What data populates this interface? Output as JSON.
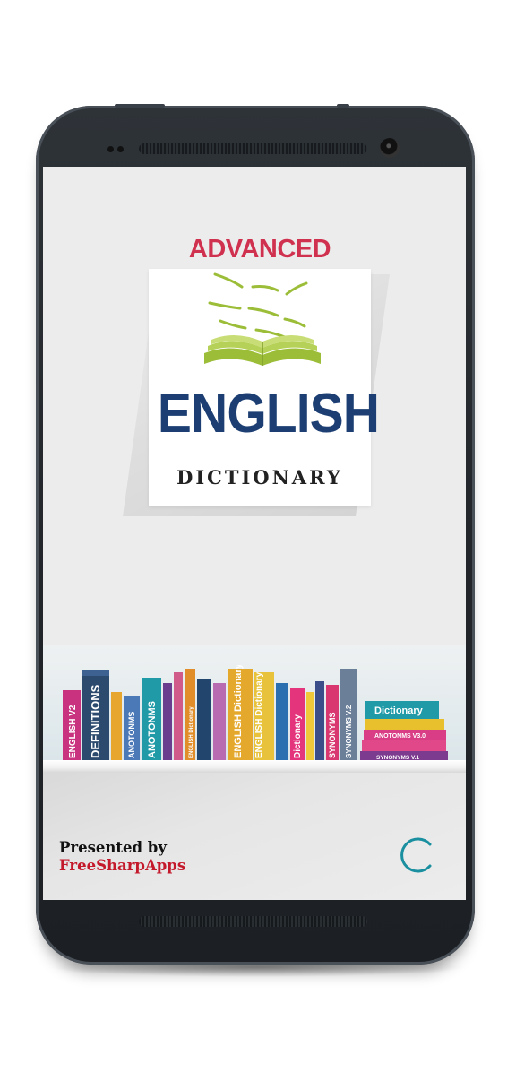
{
  "splash": {
    "logo_top": "ADVANCED",
    "logo_main": "ENGLISH",
    "logo_sub": "DICTIONARY"
  },
  "books": [
    "ENGLISH V2",
    "DEFINITIONS",
    "ANOTONMS",
    "ANOTONMS",
    "ENGLISH Dictionary",
    "ENGLISH Dictionary",
    "ENGLISH Dictionary",
    "Dictionary",
    "SYNONYMS",
    "SYNONYMS V.2"
  ],
  "stack_books": [
    "Dictionary",
    "ANOTONMS V3.0",
    "SYNONYMS V.1"
  ],
  "footer": {
    "presented_by": "Presented by",
    "brand": "FreeSharpApps"
  },
  "colors": {
    "accent_red": "#d0314f",
    "brand_blue": "#1c3e72",
    "spinner": "#1a8fa0",
    "brand_red": "#c4182b"
  }
}
